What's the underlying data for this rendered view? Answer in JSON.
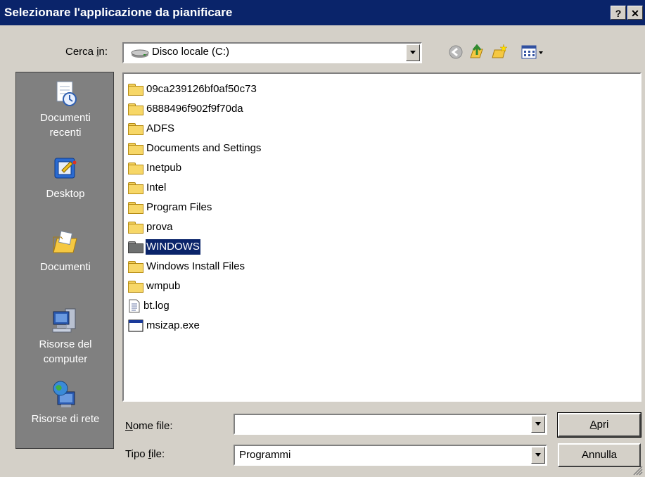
{
  "dialog": {
    "title": "Selezionare l'applicazione da pianificare",
    "help_btn": "?",
    "close_btn": "✕"
  },
  "lookin": {
    "label_pre": "Cerca ",
    "label_acc": "i",
    "label_post": "n:",
    "value": "Disco locale (C:)"
  },
  "places": [
    {
      "line1": "Documenti",
      "line2": "recenti",
      "icon": "recent-docs-icon"
    },
    {
      "line1": "Desktop",
      "line2": "",
      "icon": "desktop-icon"
    },
    {
      "line1": "Documenti",
      "line2": "",
      "icon": "documents-icon"
    },
    {
      "line1": "Risorse del",
      "line2": "computer",
      "icon": "my-computer-icon"
    },
    {
      "line1": "Risorse di rete",
      "line2": "",
      "icon": "network-icon"
    }
  ],
  "files": [
    {
      "name": "09ca239126bf0af50c73",
      "type": "folder"
    },
    {
      "name": "6888496f902f9f70da",
      "type": "folder"
    },
    {
      "name": "ADFS",
      "type": "folder"
    },
    {
      "name": "Documents and Settings",
      "type": "folder"
    },
    {
      "name": "Inetpub",
      "type": "folder"
    },
    {
      "name": "Intel",
      "type": "folder"
    },
    {
      "name": "Program Files",
      "type": "folder"
    },
    {
      "name": "prova",
      "type": "folder"
    },
    {
      "name": "WINDOWS",
      "type": "folder",
      "selected": true
    },
    {
      "name": "Windows Install Files",
      "type": "folder"
    },
    {
      "name": "wmpub",
      "type": "folder"
    },
    {
      "name": "bt.log",
      "type": "text-file"
    },
    {
      "name": "msizap.exe",
      "type": "exe"
    }
  ],
  "filename": {
    "label_acc": "N",
    "label_post": "ome file:",
    "value": ""
  },
  "filetype": {
    "label_pre": "Tipo ",
    "label_acc": "f",
    "label_post": "ile:",
    "value": "Programmi"
  },
  "buttons": {
    "open_acc": "A",
    "open_post": "pri",
    "cancel": "Annulla"
  },
  "colors": {
    "titlebar": "#0a246a",
    "face": "#d4d0c8",
    "places_bg": "#808080",
    "selection": "#0a246a"
  }
}
